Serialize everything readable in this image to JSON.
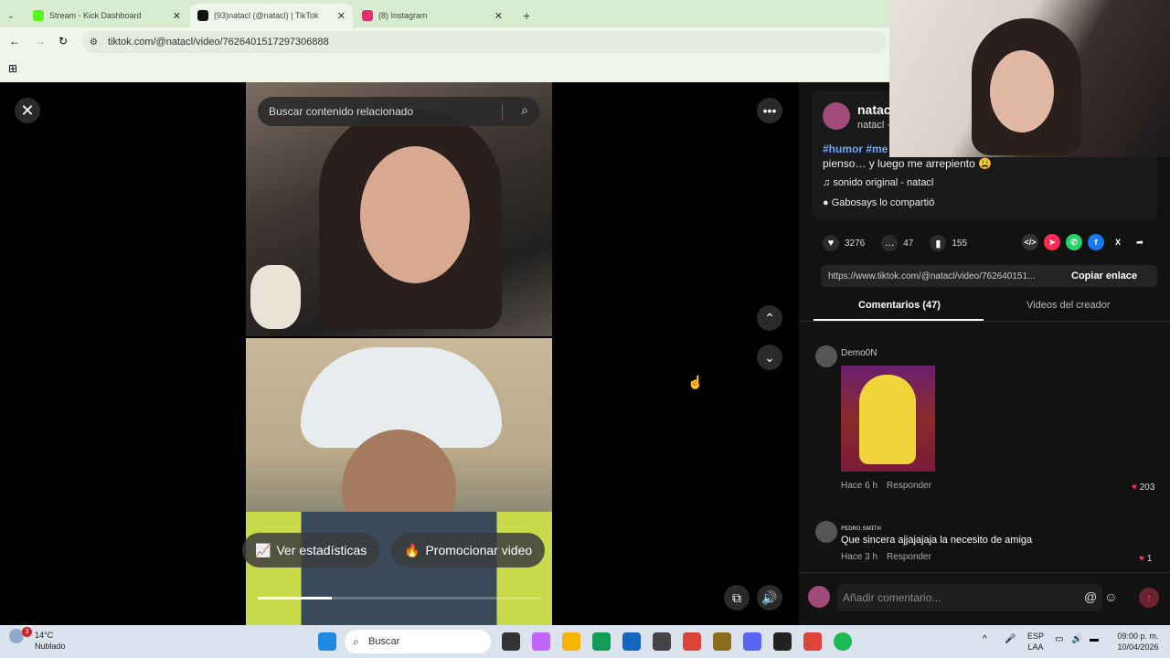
{
  "browser": {
    "tabs": [
      {
        "title": "Stream - Kick Dashboard",
        "color": "#53fc18"
      },
      {
        "title": "(93)natacl (@natacl) | TikTok",
        "color": "#000000"
      },
      {
        "title": "(8) Instagram",
        "color": "#e1306c"
      }
    ],
    "url": "tiktok.com/@natacl/video/7626401517297306888"
  },
  "video": {
    "search_placeholder": "Buscar contenido relacionado",
    "stats_button": "Ver estadísticas",
    "promote_button": "Promocionar video",
    "progress": 0.26
  },
  "post": {
    "author_name": "natac",
    "author_handle": "natacl ·",
    "tags": "#humor #me",
    "description": "pienso… y luego me arrepiento 😩",
    "sound": "sonido original - natacl",
    "shared_by": "Gabosays lo compartió",
    "likes": "3276",
    "comments": "47",
    "saves": "155",
    "link": "https://www.tiktok.com/@natacl/video/762640151...",
    "copy_link": "Copiar enlace"
  },
  "tabs": {
    "comments": "Comentarios (47)",
    "creator_videos": "Videos del creador"
  },
  "comments": [
    {
      "user": "Demo0N",
      "text": "",
      "time": "Hace 6 h",
      "reply": "Responder",
      "likes": "203"
    },
    {
      "user": "ᴘᴇᴅʀᴏ sᴍɪᴛʜ",
      "text": "Que sincera ajjajajaja la necesito de amiga",
      "time": "Hace 3 h",
      "reply": "Responder",
      "likes": "1"
    }
  ],
  "comment_bar": {
    "placeholder": "Añadir comentario..."
  },
  "taskbar": {
    "temp": "14°C",
    "weather": "Nublado",
    "weather_badge": "3",
    "search": "Buscar",
    "lang1": "ESP",
    "lang2": "LAA",
    "time": "09:00 p. m.",
    "date": "10/04/2026"
  }
}
